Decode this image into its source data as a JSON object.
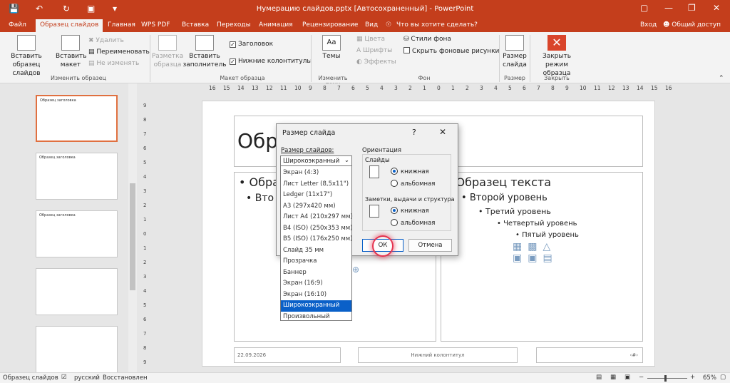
{
  "title_bar": {
    "title": "Нумерацию слайдов.pptx [Автосохраненный] - PowerPoint"
  },
  "tabs": [
    "Файл",
    "Образец слайдов",
    "Главная",
    "WPS PDF",
    "Вставка",
    "Переходы",
    "Анимация",
    "Рецензирование",
    "Вид"
  ],
  "active_tab": "Образец слайдов",
  "tell_me": "Что вы хотите сделать?",
  "sign_in": "Вход",
  "share": "Общий доступ",
  "ribbon": {
    "insert_master": "Вставить образец слайдов",
    "insert_layout": "Вставить макет",
    "delete": "Удалить",
    "rename": "Переименовать",
    "preserve": "Не изменять",
    "group_edit_master": "Изменить образец",
    "master_layout": "Разметка образца",
    "insert_placeholder": "Вставить заполнитель",
    "title_cb": "Заголовок",
    "footers_cb": "Нижние колонтитулы",
    "group_master_layout": "Макет образца",
    "themes": "Темы",
    "group_edit_theme": "Изменить тему",
    "colors": "Цвета",
    "fonts": "Шрифты",
    "effects": "Эффекты",
    "bg_styles": "Стили фона",
    "hide_bg": "Скрыть фоновые рисунки",
    "group_background": "Фон",
    "slide_size": "Размер слайда",
    "group_size": "Размер",
    "close_master": "Закрыть режим образца",
    "group_close": "Закрыть"
  },
  "ruler_h": [
    "16",
    "15",
    "14",
    "13",
    "12",
    "11",
    "10",
    "9",
    "8",
    "7",
    "6",
    "5",
    "4",
    "3",
    "2",
    "1",
    "0",
    "1",
    "2",
    "3",
    "4",
    "5",
    "6",
    "7",
    "8",
    "9",
    "10",
    "11",
    "12",
    "13",
    "14",
    "15",
    "16"
  ],
  "ruler_v": [
    "9",
    "8",
    "7",
    "6",
    "5",
    "4",
    "3",
    "2",
    "1",
    "0",
    "1",
    "2",
    "3",
    "4",
    "5",
    "6",
    "7",
    "8",
    "9"
  ],
  "thumbs": [
    "Образец заголовка",
    "Образец заголовка",
    "Образец заголовка",
    "",
    ""
  ],
  "slide": {
    "title": "Обра",
    "left_l1": "Образ",
    "left_l2": "Вто",
    "right_l1": "Образец текста",
    "right_l2": "Второй уровень",
    "right_l3": "Третий уровень",
    "right_l4": "Четвертый уровень",
    "right_l5": "Пятый уровень",
    "date": "22.09.2026",
    "footer": "Нижний колонтитул",
    "num": "‹#›"
  },
  "dialog": {
    "title": "Размер слайда",
    "help": "?",
    "size_label": "Размер слайдов:",
    "size_value": "Широкоэкранный",
    "orientation": "Ориентация",
    "slides": "Слайды",
    "portrait": "книжная",
    "landscape": "альбомная",
    "notes": "Заметки, выдачи и структура",
    "notes_portrait": "книжная",
    "notes_landscape": "альбомная",
    "ok": "ОК",
    "cancel": "Отмена",
    "options": [
      "Экран (4:3)",
      "Лист Letter (8,5x11\")",
      "Ledger (11x17\")",
      "А3 (297x420 мм)",
      "Лист А4 (210x297 мм)",
      "B4 (ISO) (250x353 мм)",
      "B5 (ISO) (176x250 мм)",
      "Слайд 35 мм",
      "Прозрачка",
      "Баннер",
      "Экран (16:9)",
      "Экран (16:10)",
      "Широкоэкранный",
      "Произвольный"
    ],
    "selected_option": "Широкоэкранный"
  },
  "status": {
    "view": "Образец слайдов",
    "lang": "русский",
    "recovered": "Восстановлен",
    "zoom": "65%"
  },
  "colors": {
    "accent": "#c43e1c",
    "select": "#0a60c8"
  }
}
